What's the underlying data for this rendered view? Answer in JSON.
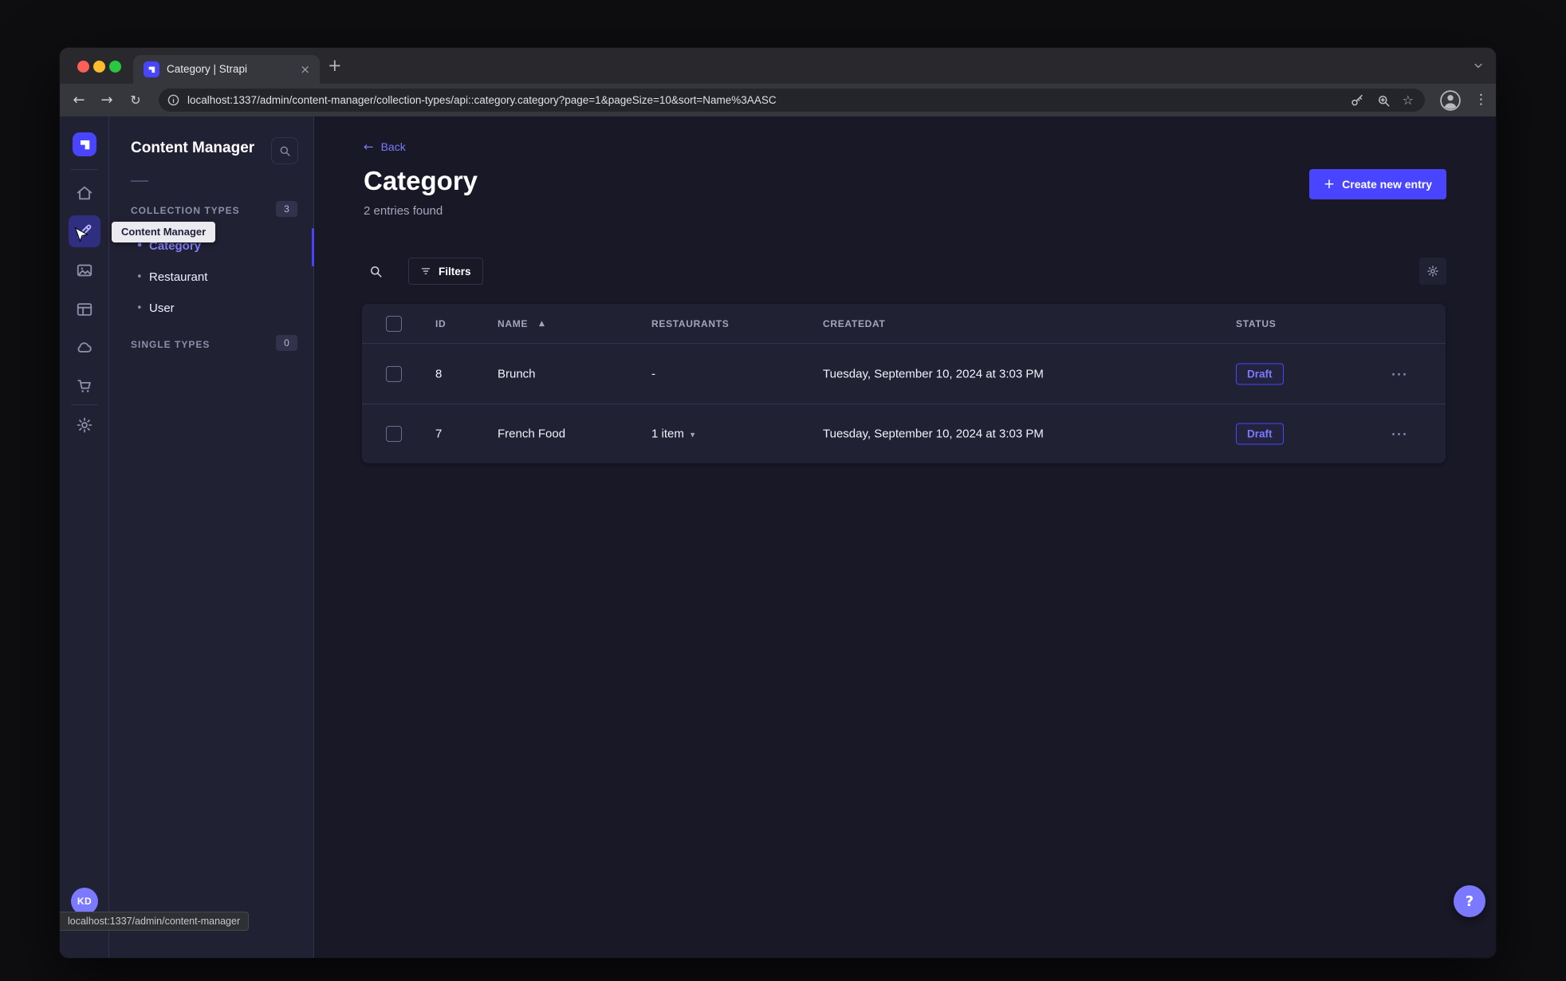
{
  "colors": {
    "accent": "#4945ff",
    "accent_light": "#7b79ff",
    "app_bg": "#181826",
    "panel_bg": "#212134",
    "border": "#32324d"
  },
  "glyphs": {
    "back_arrow": "←",
    "forward_arrow": "→",
    "reload": "↻",
    "star": "☆",
    "v_ellipsis": "⋮",
    "h_ellipsis": "⋯",
    "plus": "+",
    "close": "×",
    "sort_asc": "▲",
    "caret_down": "▾",
    "question": "?",
    "bullet": "•"
  },
  "browser": {
    "tab_title": "Category | Strapi",
    "url": "localhost:1337/admin/content-manager/collection-types/api::category.category?page=1&pageSize=10&sort=Name%3AASC",
    "status_bubble": "localhost:1337/admin/content-manager"
  },
  "rail": {
    "tooltip": "Content Manager",
    "avatar": "KD"
  },
  "sidebar": {
    "title": "Content Manager",
    "collection_label": "COLLECTION TYPES",
    "collection_count": "3",
    "items": [
      {
        "label": "Category"
      },
      {
        "label": "Restaurant"
      },
      {
        "label": "User"
      }
    ],
    "single_label": "SINGLE TYPES",
    "single_count": "0"
  },
  "main": {
    "back": "Back",
    "title": "Category",
    "subtitle": "2 entries found",
    "create": "Create new entry",
    "filters": "Filters",
    "table": {
      "headers": {
        "id": "ID",
        "name": "NAME",
        "restaurants": "RESTAURANTS",
        "createdat": "CREATEDAT",
        "status": "STATUS"
      },
      "rows": [
        {
          "id": "8",
          "name": "Brunch",
          "restaurants": "-",
          "createdat": "Tuesday, September 10, 2024 at 3:03 PM",
          "status": "Draft"
        },
        {
          "id": "7",
          "name": "French Food",
          "restaurants": "1 item",
          "createdat": "Tuesday, September 10, 2024 at 3:03 PM",
          "status": "Draft"
        }
      ]
    }
  }
}
